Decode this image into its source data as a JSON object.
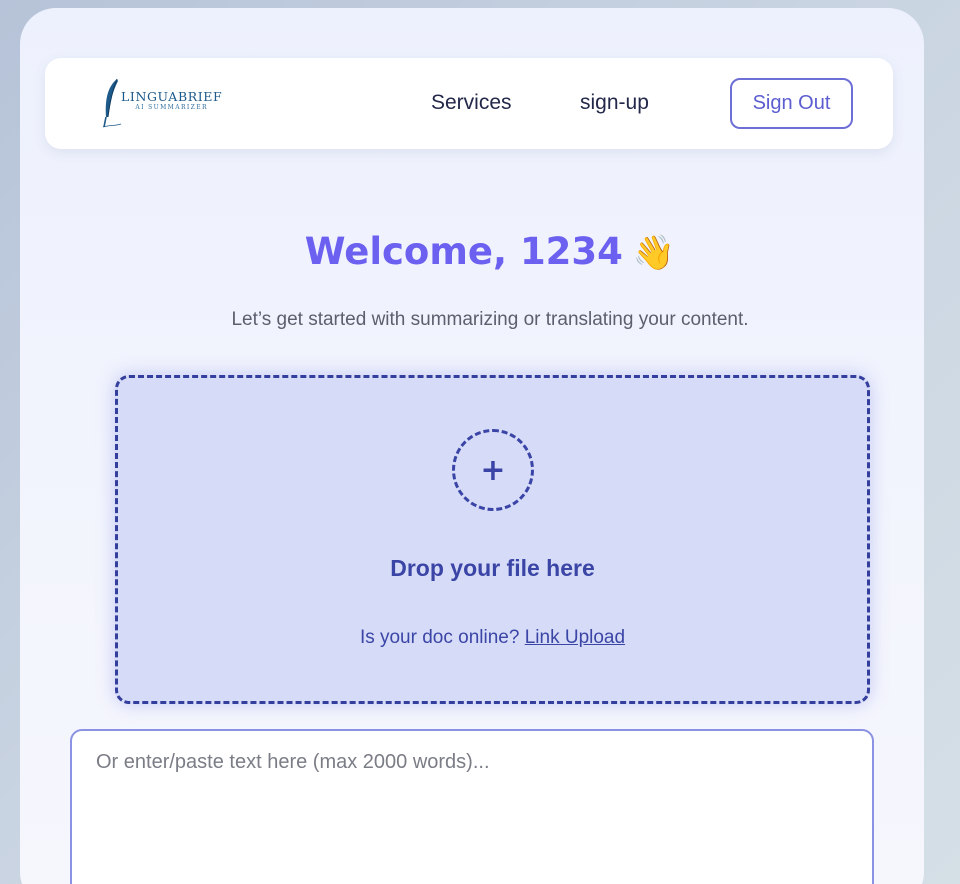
{
  "nav": {
    "logo_main": "LINGUABRIEF",
    "logo_sub": "AI SUMMARIZER",
    "links": [
      "Services",
      "sign-up"
    ],
    "signout_label": "Sign Out"
  },
  "hero": {
    "welcome": "Welcome, 1234",
    "wave_emoji": "👋",
    "subtitle": "Let’s get started with summarizing or translating your content."
  },
  "dropzone": {
    "plus": "+",
    "title": "Drop your file here",
    "online_prompt": "Is your doc online?",
    "link_label": "Link Upload"
  },
  "text_input": {
    "placeholder": "Or enter/paste text here (max 2000 words)...",
    "value": ""
  },
  "colors": {
    "accent": "#6b60ef",
    "dropzone_bg": "#d6dcf8",
    "dropzone_border": "#343e9c",
    "nav_text": "#23284a"
  }
}
